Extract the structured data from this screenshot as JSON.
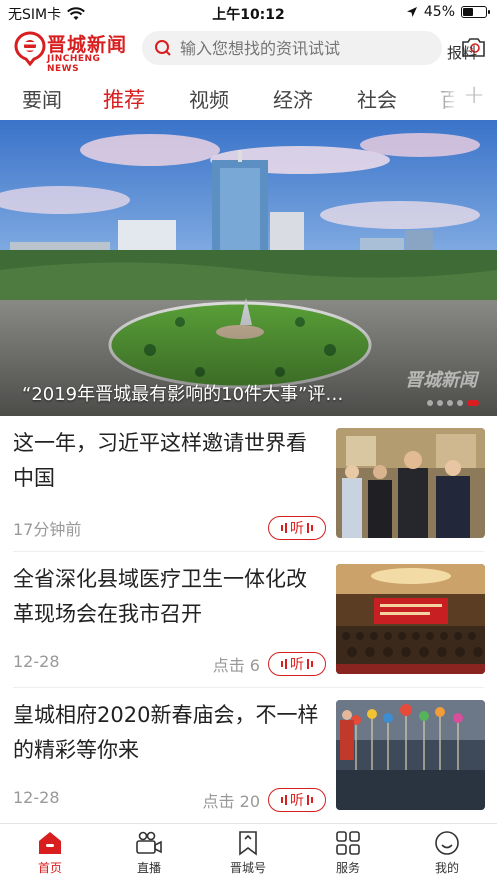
{
  "status": {
    "carrier": "无SIM卡",
    "time": "上午10:12",
    "battery_text": "45%",
    "battery_level": 0.45
  },
  "header": {
    "logo_name": "晋城新闻",
    "logo_sub": "JINCHENG NEWS",
    "search_placeholder": "输入您想找的资讯试试",
    "report_label": "报料"
  },
  "tabs": [
    {
      "label": "要闻"
    },
    {
      "label": "推荐",
      "active": true
    },
    {
      "label": "视频"
    },
    {
      "label": "经济"
    },
    {
      "label": "社会"
    },
    {
      "label": "百"
    }
  ],
  "banner": {
    "caption": "“2019年晋城最有影响的10件大事”评…",
    "watermark": "晋城新闻",
    "slide_count": 5,
    "active_slide": 5
  },
  "feed": [
    {
      "title": "这一年，习近平这样邀请世界看中国",
      "meta": "17分钟前",
      "clicks": "",
      "listen_label": "听"
    },
    {
      "title": "全省深化县域医疗卫生一体化改革现场会在我市召开",
      "meta": "12-28",
      "clicks": "点击 6",
      "listen_label": "听"
    },
    {
      "title": "皇城相府2020新春庙会，不一样的精彩等你来",
      "meta": "12-28",
      "clicks": "点击 20",
      "listen_label": "听"
    }
  ],
  "bottom_nav": [
    {
      "label": "首页",
      "icon": "home-icon",
      "active": true
    },
    {
      "label": "直播",
      "icon": "live-camera-icon"
    },
    {
      "label": "晋城号",
      "icon": "bookmark-icon"
    },
    {
      "label": "服务",
      "icon": "grid-icon"
    },
    {
      "label": "我的",
      "icon": "profile-icon"
    }
  ],
  "colors": {
    "brand_red": "#d81e1e",
    "muted_text": "#999999"
  }
}
